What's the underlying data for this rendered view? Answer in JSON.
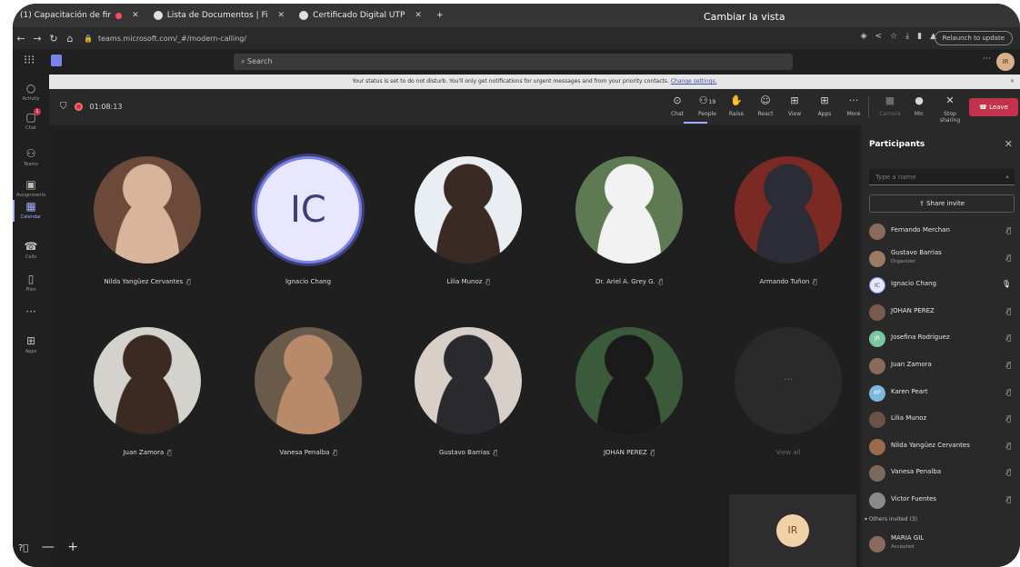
{
  "browser": {
    "tabs": [
      {
        "label": "(1) Capacitación de fir",
        "recording": true
      },
      {
        "label": "Lista de Documentos | Fi"
      },
      {
        "label": "Certificado Digital UTP"
      }
    ],
    "new_tab": "+",
    "overlay_text": "Cambiar la vista",
    "url": "teams.microsoft.com/_#/modern-calling/",
    "relaunch_label": "Relaunch to update"
  },
  "teams": {
    "search_placeholder": "Search",
    "user_initials": "IR",
    "more": "···",
    "rail": [
      {
        "label": "Activity",
        "icon": "bell-icon",
        "glyph": "○"
      },
      {
        "label": "Chat",
        "icon": "chat-icon",
        "glyph": "▢",
        "badge": "1"
      },
      {
        "label": "Teams",
        "icon": "teams-icon",
        "glyph": "⚇"
      },
      {
        "label": "Assignments",
        "icon": "assignments-icon",
        "glyph": "▣"
      },
      {
        "label": "Calendar",
        "icon": "calendar-icon",
        "glyph": "▦",
        "active": true
      },
      {
        "label": "Calls",
        "icon": "phone-icon",
        "glyph": "☎"
      },
      {
        "label": "Files",
        "icon": "file-icon",
        "glyph": "▯"
      },
      {
        "label": "",
        "icon": "more-icon",
        "glyph": "···"
      },
      {
        "label": "Apps",
        "icon": "apps-icon",
        "glyph": "⊞"
      }
    ],
    "notification": {
      "text": "Your status is set to do not disturb. You'll only get notifications for urgent messages and from your priority contacts.",
      "link": "Change settings."
    }
  },
  "meeting": {
    "timer": "01:08:13",
    "toolbar": [
      {
        "key": "chat",
        "label": "Chat",
        "glyph": "⊙"
      },
      {
        "key": "people",
        "label": "People",
        "glyph": "⚇",
        "count": "19"
      },
      {
        "key": "raise",
        "label": "Raise",
        "glyph": "✋"
      },
      {
        "key": "react",
        "label": "React",
        "glyph": "☺"
      },
      {
        "key": "view",
        "label": "View",
        "glyph": "⊞"
      },
      {
        "key": "apps",
        "label": "Apps",
        "glyph": "⊞"
      },
      {
        "key": "more",
        "label": "More",
        "glyph": "···"
      },
      {
        "key": "camera",
        "label": "Camera",
        "glyph": "■",
        "dim": true
      },
      {
        "key": "mic",
        "label": "Mic",
        "glyph": "●"
      },
      {
        "key": "stopshare",
        "label": "Stop sharing",
        "glyph": "✕"
      }
    ],
    "leave_label": "Leave",
    "tiles": [
      {
        "name": "Nilda Yangüez Cervantes",
        "colors": [
          "#6b4a3a",
          "#d8b49a"
        ]
      },
      {
        "name": "Ignacio Chang",
        "initials": "IC"
      },
      {
        "name": "Lilia Munoz",
        "colors": [
          "#e9eef2",
          "#3a2a24"
        ]
      },
      {
        "name": "Dr. Ariel A. Grey G.",
        "colors": [
          "#5d7a52",
          "#f2f2f2"
        ]
      },
      {
        "name": "Armando Tuñon",
        "colors": [
          "#7a2a22",
          "#2c2c36"
        ]
      },
      {
        "name": "Juan Zamora",
        "colors": [
          "#d4d2cc",
          "#3a2a22"
        ]
      },
      {
        "name": "Vanesa Penalba",
        "colors": [
          "#6a5a4a",
          "#b88a6a"
        ]
      },
      {
        "name": "Gustavo Barrias",
        "colors": [
          "#d8d0c8",
          "#2a2a2e"
        ]
      },
      {
        "name": "JOHAN PEREZ",
        "colors": [
          "#3a5a3a",
          "#1a1a1a"
        ]
      }
    ],
    "view_all": {
      "glyph": "···",
      "label": "View all"
    },
    "self_initials": "IR"
  },
  "participants": {
    "title": "Participants",
    "search_placeholder": "Type a name",
    "share_invite": "Share invite",
    "list": [
      {
        "name": "Fernando Merchan",
        "avatar": "#8a6a5a"
      },
      {
        "name": "Gustavo Barrias",
        "sub": "Organizer",
        "avatar": "#9a7a62"
      },
      {
        "name": "Ignacio Chang",
        "initials": "IC",
        "avatar": "#e9e6ff",
        "mic_on": true
      },
      {
        "name": "JOHAN PEREZ",
        "avatar": "#7a5a4a"
      },
      {
        "name": "Josefina Rodriguez",
        "initials": "JR",
        "avatar": "#7bc6a0"
      },
      {
        "name": "Juan Zamora",
        "avatar": "#8a6a58"
      },
      {
        "name": "Karen Peart",
        "initials": "KP",
        "avatar": "#7ab8e0"
      },
      {
        "name": "Lilia Munoz",
        "avatar": "#6a5248"
      },
      {
        "name": "Nilda Yangüez Cervantes",
        "avatar": "#9a6a4a"
      },
      {
        "name": "Vanesa Penalba",
        "avatar": "#7a6a5e"
      },
      {
        "name": "Victor Fuentes",
        "avatar": "#8a8a8a"
      }
    ],
    "others_label": "Others invited (3)",
    "invited": [
      {
        "name": "MARIA GIL",
        "sub": "Accepted",
        "avatar": "#8a6a5a"
      }
    ]
  }
}
